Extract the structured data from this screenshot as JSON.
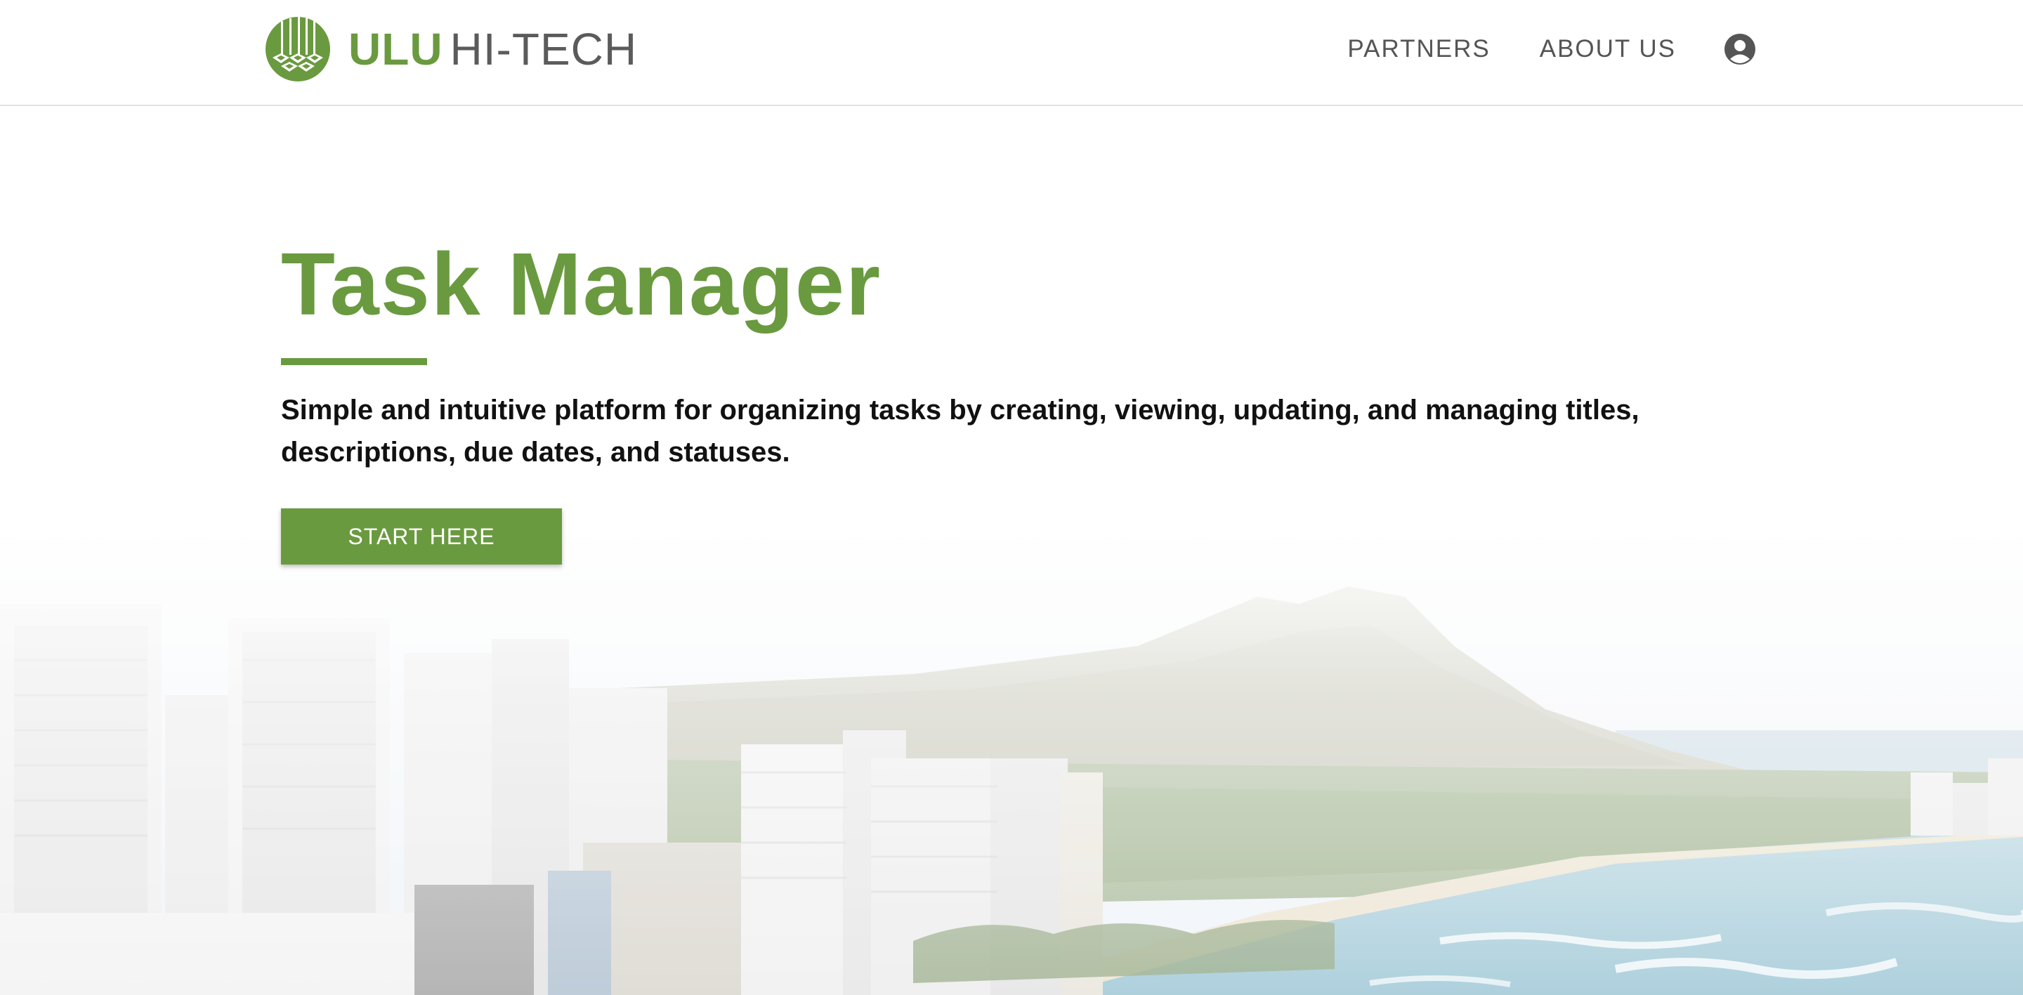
{
  "brand": {
    "name_primary": "ULU",
    "name_secondary": "HI-TECH",
    "logo_icon": "ulu-tribal-mark-icon",
    "color_green": "#6a9a3f",
    "color_gray": "#5b5b5b"
  },
  "nav": {
    "items": [
      {
        "label": "PARTNERS"
      },
      {
        "label": "ABOUT US"
      }
    ],
    "account_icon": "user-circle-icon"
  },
  "hero": {
    "title": "Task Manager",
    "description": "Simple and intuitive platform for organizing tasks by creating, viewing, updating, and managing titles, descriptions, due dates, and statuses.",
    "cta_label": "START HERE",
    "background": "waikiki-diamond-head-skyline"
  }
}
